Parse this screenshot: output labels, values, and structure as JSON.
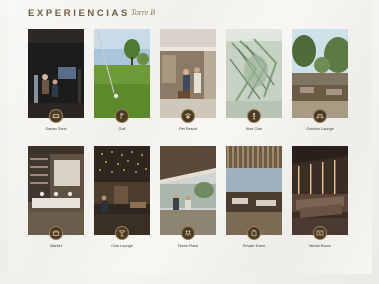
{
  "header": {
    "title": "EXPERIENCIAS",
    "subtitle": "Torre B"
  },
  "experiences": [
    {
      "label": "Gamer Zone",
      "icon": "gamepad-icon"
    },
    {
      "label": "Golf",
      "icon": "golf-icon"
    },
    {
      "label": "Pet Resort",
      "icon": "paw-icon"
    },
    {
      "label": "Kids Club",
      "icon": "kids-icon"
    },
    {
      "label": "Outdoor Lounge",
      "icon": "lounge-icon"
    },
    {
      "label": "Market",
      "icon": "market-icon"
    },
    {
      "label": "Club Lounge",
      "icon": "cocktail-icon"
    },
    {
      "label": "Teens Place",
      "icon": "teens-icon"
    },
    {
      "label": "Private Event",
      "icon": "event-icon"
    },
    {
      "label": "Media Room",
      "icon": "media-icon"
    }
  ],
  "colors": {
    "accent": "#6f5f47",
    "badge": "#4a3b26",
    "badge_border": "#9b8157"
  }
}
